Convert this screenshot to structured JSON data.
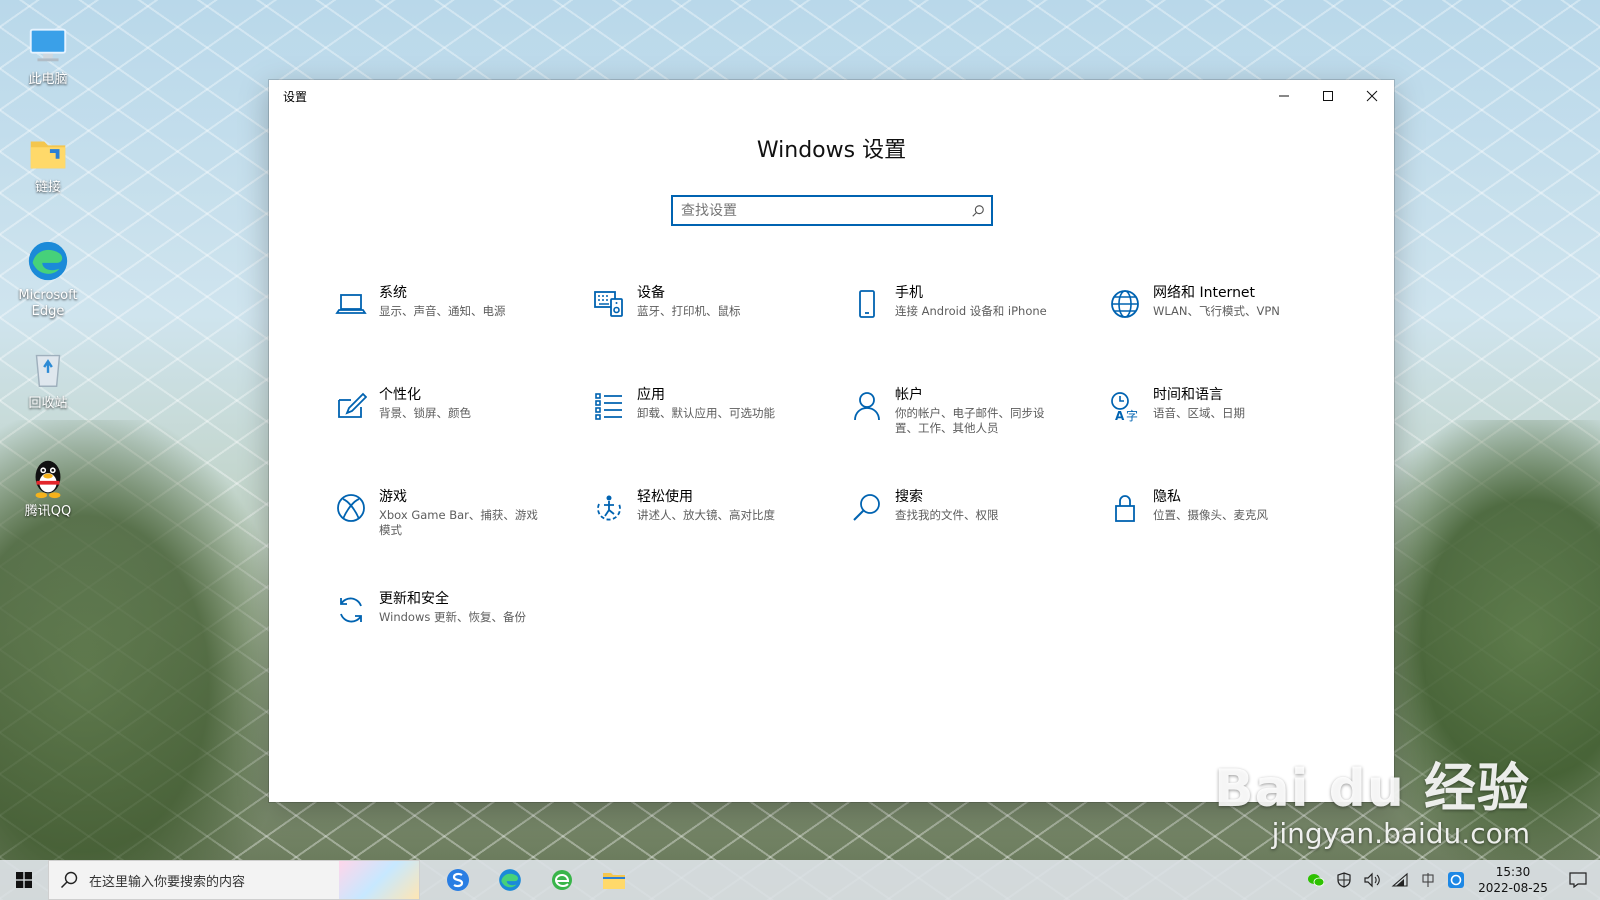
{
  "desktop": {
    "icons": [
      {
        "label": "此电脑"
      },
      {
        "label": "链接"
      },
      {
        "label": "Microsoft Edge"
      },
      {
        "label": "回收站"
      },
      {
        "label": "腾讯QQ"
      }
    ]
  },
  "window": {
    "title": "设置",
    "heading": "Windows 设置",
    "search_placeholder": "查找设置",
    "accent": "#0063b1",
    "tiles": [
      {
        "icon": "laptop-icon",
        "name": "系统",
        "desc": "显示、声音、通知、电源"
      },
      {
        "icon": "devices-icon",
        "name": "设备",
        "desc": "蓝牙、打印机、鼠标"
      },
      {
        "icon": "phone-icon",
        "name": "手机",
        "desc": "连接 Android 设备和 iPhone"
      },
      {
        "icon": "globe-icon",
        "name": "网络和 Internet",
        "desc": "WLAN、飞行模式、VPN"
      },
      {
        "icon": "personalization-icon",
        "name": "个性化",
        "desc": "背景、锁屏、颜色"
      },
      {
        "icon": "apps-list-icon",
        "name": "应用",
        "desc": "卸载、默认应用、可选功能"
      },
      {
        "icon": "person-icon",
        "name": "帐户",
        "desc": "你的帐户、电子邮件、同步设置、工作、其他人员"
      },
      {
        "icon": "time-language-icon",
        "name": "时间和语言",
        "desc": "语音、区域、日期"
      },
      {
        "icon": "xbox-icon",
        "name": "游戏",
        "desc": "Xbox Game Bar、捕获、游戏模式"
      },
      {
        "icon": "ease-of-access-icon",
        "name": "轻松使用",
        "desc": "讲述人、放大镜、高对比度"
      },
      {
        "icon": "search-icon",
        "name": "搜索",
        "desc": "查找我的文件、权限"
      },
      {
        "icon": "lock-icon",
        "name": "隐私",
        "desc": "位置、摄像头、麦克风"
      },
      {
        "icon": "update-icon",
        "name": "更新和安全",
        "desc": "Windows 更新、恢复、备份"
      }
    ]
  },
  "taskbar": {
    "search_placeholder": "在这里输入你要搜索的内容",
    "time": "15:30",
    "date": "2022-08-25"
  },
  "watermark": {
    "main": "Bai du 经验",
    "url": "jingyan.baidu.com"
  }
}
